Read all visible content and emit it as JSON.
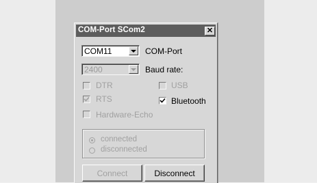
{
  "window": {
    "title": "COM-Port SCom2",
    "close_glyph": "✕"
  },
  "port": {
    "value": "COM11",
    "label": "COM-Port"
  },
  "baud": {
    "value": "2400",
    "label": "Baud rate:"
  },
  "options": {
    "dtr": {
      "label": "DTR",
      "checked": false
    },
    "rts": {
      "label": "RTS",
      "checked": true
    },
    "usb": {
      "label": "USB",
      "checked": false
    },
    "bluetooth": {
      "label": "Bluetooth",
      "checked": true
    },
    "hardware_echo": {
      "label": "Hardware-Echo",
      "checked": false
    }
  },
  "status": {
    "connected_label": "connected",
    "disconnected_label": "disconnected",
    "selected": "connected"
  },
  "buttons": {
    "connect_label": "Connect",
    "disconnect_label": "Disconnect"
  },
  "colors": {
    "titlebar": "#5d5d5d",
    "dialog_face": "#d7d7d7",
    "disabled_text": "#a0a0a0"
  }
}
